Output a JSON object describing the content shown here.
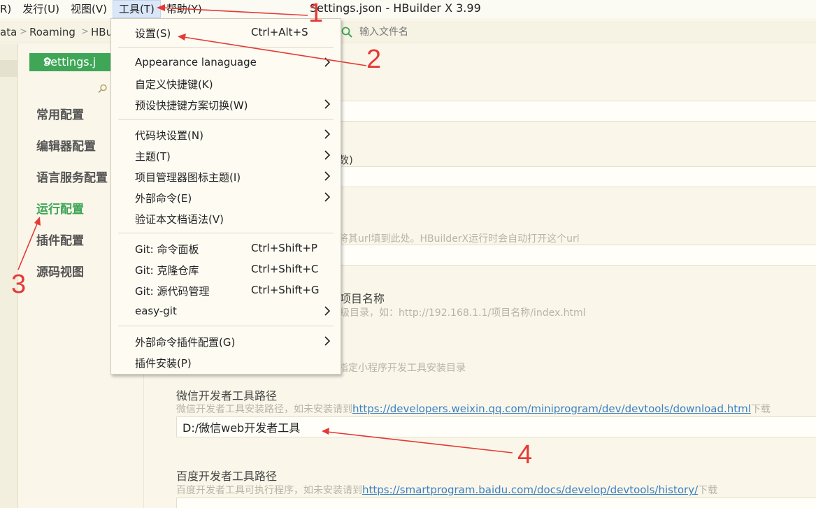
{
  "window": {
    "title": "Settings.json - HBuilder X 3.99"
  },
  "menubar": {
    "items": [
      "R)",
      "发行(U)",
      "视图(V)",
      "工具(T)",
      "帮助(Y)"
    ]
  },
  "breadcrumb": {
    "items": [
      "ata",
      "Roaming",
      "HBu"
    ],
    "separator": ">",
    "search_placeholder": "输入文件名"
  },
  "tools_menu": {
    "items": [
      {
        "label": "设置(S)",
        "shortcut": "Ctrl+Alt+S",
        "submenu": false
      },
      {
        "label": "Appearance lanaguage",
        "shortcut": "",
        "submenu": true
      },
      {
        "label": "自定义快捷键(K)",
        "shortcut": "",
        "submenu": false
      },
      {
        "label": "预设快捷键方案切换(W)",
        "shortcut": "",
        "submenu": true
      },
      {
        "label": "代码块设置(N)",
        "shortcut": "",
        "submenu": true
      },
      {
        "label": "主题(T)",
        "shortcut": "",
        "submenu": true
      },
      {
        "label": "项目管理器图标主题(I)",
        "shortcut": "",
        "submenu": true
      },
      {
        "label": "外部命令(E)",
        "shortcut": "",
        "submenu": true
      },
      {
        "label": "验证本文档语法(V)",
        "shortcut": "",
        "submenu": false
      },
      {
        "label": "Git: 命令面板",
        "shortcut": "Ctrl+Shift+P",
        "submenu": false
      },
      {
        "label": "Git: 克隆仓库",
        "shortcut": "Ctrl+Shift+C",
        "submenu": false
      },
      {
        "label": "Git: 源代码管理",
        "shortcut": "Ctrl+Shift+G",
        "submenu": false
      },
      {
        "label": "easy-git",
        "shortcut": "",
        "submenu": true
      },
      {
        "label": "外部命令插件配置(G)",
        "shortcut": "",
        "submenu": true
      },
      {
        "label": "插件安装(P)",
        "shortcut": "",
        "submenu": false
      }
    ]
  },
  "settings": {
    "tab_label": "Settings.j",
    "nav": [
      {
        "label": "常用配置",
        "active": false
      },
      {
        "label": "编辑器配置",
        "active": false
      },
      {
        "label": "语言服务配置",
        "active": false
      },
      {
        "label": "运行配置",
        "active": true
      },
      {
        "label": "插件配置",
        "active": false
      },
      {
        "label": "源码视图",
        "active": false
      }
    ],
    "partial_text": {
      "frag1": "数)",
      "frag2": "将其url填到此处。HBuilderX运行时会自动打开这个url",
      "frag3": "项目名称",
      "frag4": "级目录，如：http://192.168.1.1/项目名称/index.html",
      "frag5": "指定小程序开发工具安装目录"
    },
    "wechat": {
      "title": "微信开发者工具路径",
      "desc_prefix": "微信开发者工具安装路径，如未安装请到",
      "link": "https://developers.weixin.qq.com/miniprogram/dev/devtools/download.html",
      "desc_suffix": "下载",
      "value": "D:/微信web开发者工具"
    },
    "baidu": {
      "title": "百度开发者工具路径",
      "desc_prefix": "百度开发者工具可执行程序，如未安装请到",
      "link": "https://smartprogram.baidu.com/docs/develop/devtools/history/",
      "desc_suffix": "下载"
    }
  },
  "annotations": [
    "1",
    "2",
    "3",
    "4"
  ],
  "colors": {
    "accent_green": "#3fa658",
    "annotation_red": "#e53935",
    "link_blue": "#3b7fc4",
    "background": "#faf7ea"
  }
}
